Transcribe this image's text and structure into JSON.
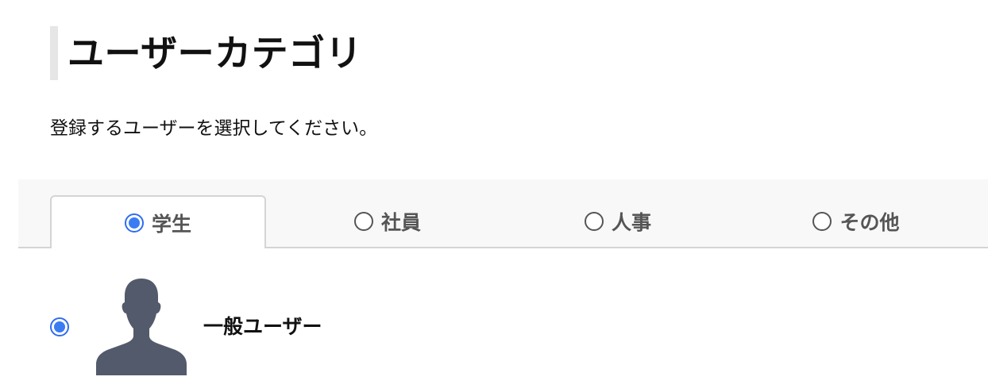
{
  "page": {
    "title": "ユーザーカテゴリ",
    "instruction": "登録するユーザーを選択してください。"
  },
  "tabs": [
    {
      "label": "学生",
      "selected": true
    },
    {
      "label": "社員",
      "selected": false
    },
    {
      "label": "人事",
      "selected": false
    },
    {
      "label": "その他",
      "selected": false
    }
  ],
  "user_options": [
    {
      "label": "一般ユーザー",
      "selected": true,
      "icon": "user-silhouette-icon"
    }
  ],
  "colors": {
    "accent": "#3b7cf3",
    "tab_bar_bg": "#f8f8f8",
    "border": "#d4d4d4",
    "avatar": "#525a6b"
  }
}
